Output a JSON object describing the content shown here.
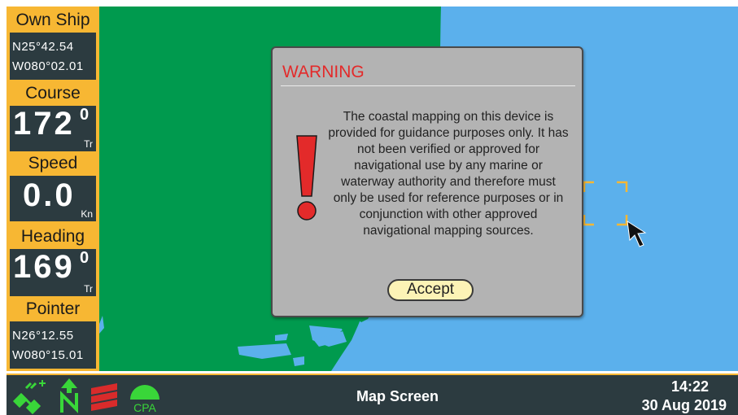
{
  "sidebar": {
    "own_ship": {
      "label": "Own Ship",
      "lat": "N25°42.54",
      "lon": "W080°02.01"
    },
    "course": {
      "label": "Course",
      "value": "172",
      "deg": "0",
      "unit": "Tr"
    },
    "speed": {
      "label": "Speed",
      "value": "0.0",
      "unit": "Kn"
    },
    "heading": {
      "label": "Heading",
      "value": "169",
      "deg": "0",
      "unit": "Tr"
    },
    "pointer": {
      "label": "Pointer",
      "lat": "N26°12.55",
      "lon": "W080°15.01"
    }
  },
  "dialog": {
    "title": "WARNING",
    "message": "The coastal mapping on this device is provided for guidance purposes only. It has not been verified or approved for navigational use by any marine or waterway authority and therefore must only be used for reference purposes or in conjunction with other approved navigational mapping sources.",
    "accept_label": "Accept"
  },
  "bottom": {
    "screen_title": "Map Screen",
    "time": "14:22",
    "date": "30 Aug 2019",
    "icons": [
      "satellite-icon",
      "north-up-icon",
      "layers-icon",
      "cpa-icon"
    ],
    "cpa_label": "CPA"
  },
  "colors": {
    "panel": "#f7b733",
    "dark": "#2c3b40",
    "land": "#009a4e",
    "water": "#5bb0ec",
    "warning": "#e32a2a",
    "icon_green": "#39d639"
  }
}
